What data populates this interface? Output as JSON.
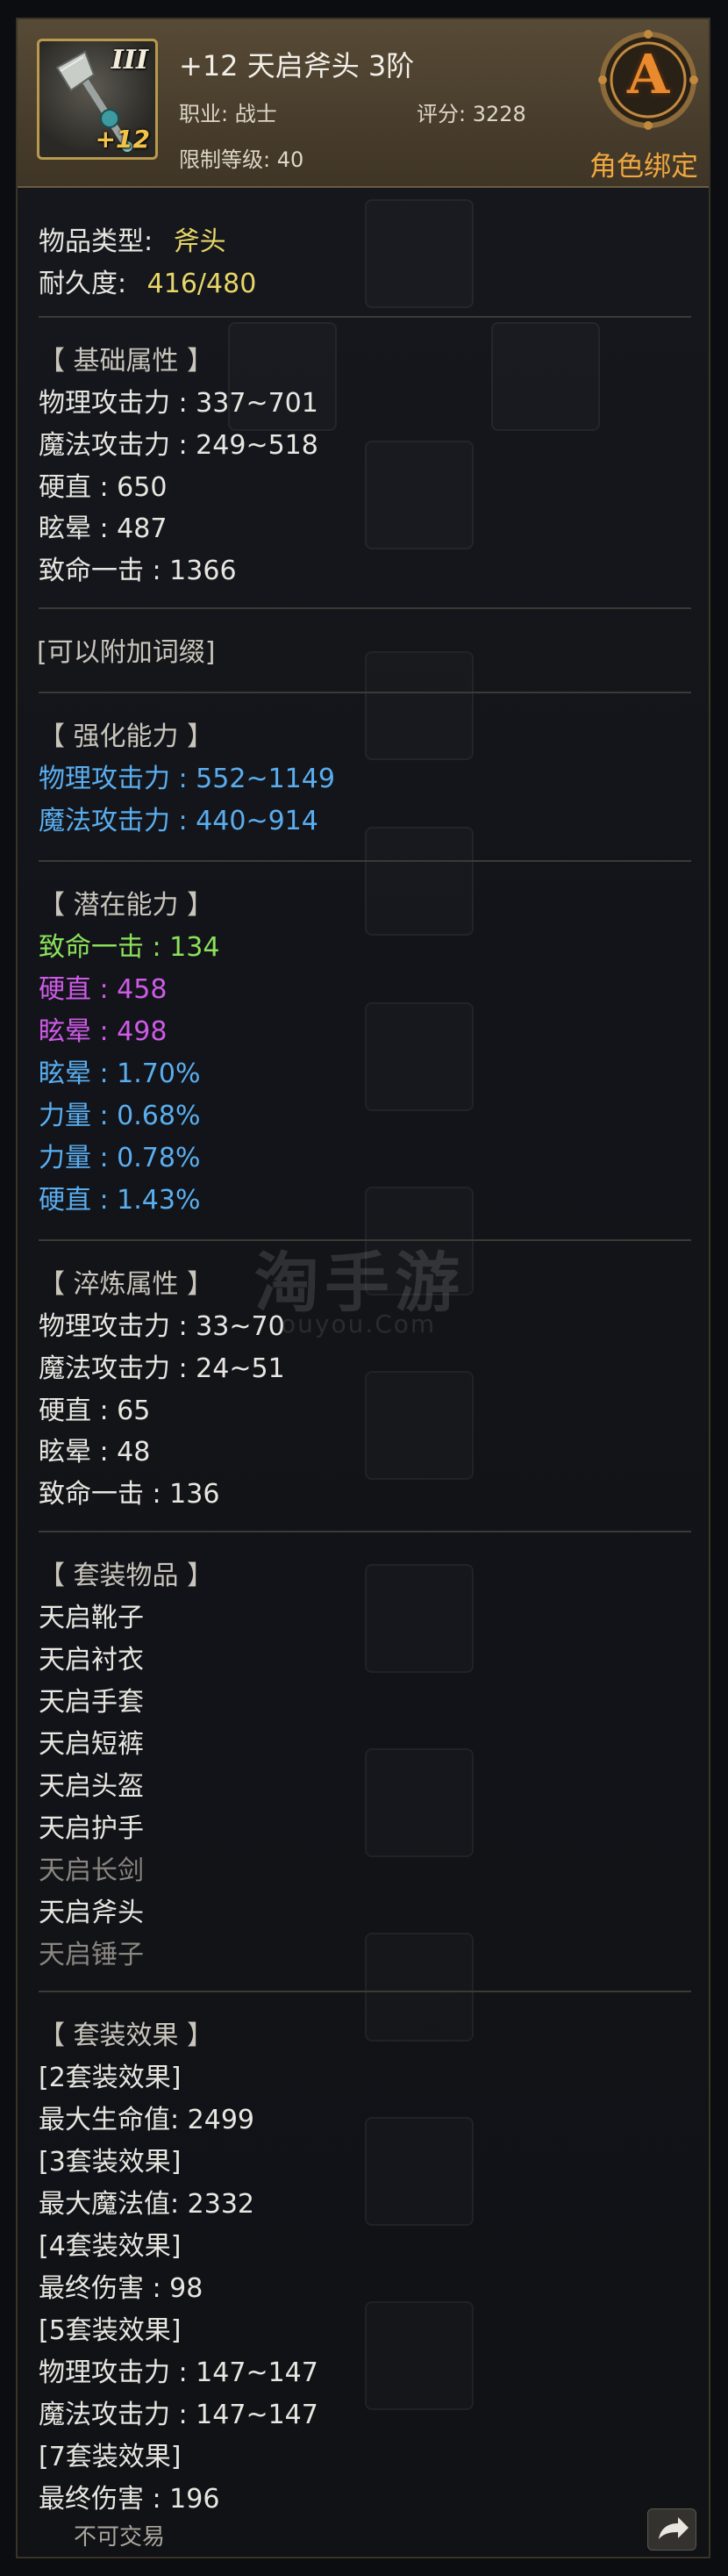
{
  "header": {
    "title": "+12 天启斧头 3阶",
    "job": "职业: 战士",
    "score": "评分: 3228",
    "level_req": "限制等级: 40",
    "grade": "A",
    "bind": "角色绑定",
    "icon_tier": "III",
    "icon_plus": "+12"
  },
  "basic": {
    "type_label": "物品类型:",
    "type_value": "斧头",
    "dur_label": "耐久度:",
    "dur_value": "416/480"
  },
  "base_stats": {
    "heading": "【 基础属性 】",
    "lines": [
      "物理攻击力 : 337~701",
      "魔法攻击力 : 249~518",
      "硬直 : 650",
      "眩晕 : 487",
      "致命一击 : 1366"
    ]
  },
  "affix": "[可以附加词缀]",
  "enhance": {
    "heading": "【 强化能力 】",
    "lines": [
      "物理攻击力 : 552~1149",
      "魔法攻击力 : 440~914"
    ]
  },
  "potential": {
    "heading": "【 潜在能力 】",
    "lines": [
      {
        "text": "致命一击 : 134",
        "color": "#8ce05a"
      },
      {
        "text": "硬直 : 458",
        "color": "#cf5ae8"
      },
      {
        "text": "眩晕 : 498",
        "color": "#cf5ae8"
      },
      {
        "text": "眩晕 : 1.70%",
        "color": "#5aaef0"
      },
      {
        "text": "力量 : 0.68%",
        "color": "#5aaef0"
      },
      {
        "text": "力量 : 0.78%",
        "color": "#5aaef0"
      },
      {
        "text": "硬直 : 1.43%",
        "color": "#5aaef0"
      }
    ]
  },
  "refine": {
    "heading": "【 淬炼属性 】",
    "lines": [
      "物理攻击力 : 33~70",
      "魔法攻击力 : 24~51",
      "硬直 : 65",
      "眩晕 : 48",
      "致命一击 : 136"
    ]
  },
  "set_items": {
    "heading": "【 套装物品 】",
    "items": [
      {
        "name": "天启靴子",
        "owned": true
      },
      {
        "name": "天启衬衣",
        "owned": true
      },
      {
        "name": "天启手套",
        "owned": true
      },
      {
        "name": "天启短裤",
        "owned": true
      },
      {
        "name": "天启头盔",
        "owned": true
      },
      {
        "name": "天启护手",
        "owned": true
      },
      {
        "name": "天启长剑",
        "owned": false
      },
      {
        "name": "天启斧头",
        "owned": true
      },
      {
        "name": "天启锤子",
        "owned": false
      }
    ]
  },
  "set_effects": {
    "heading": "【 套装效果 】",
    "lines": [
      "[2套装效果]",
      "最大生命值:   2499",
      "[3套装效果]",
      "最大魔法值:   2332",
      "[4套装效果]",
      "最终伤害 : 98",
      "[5套装效果]",
      "物理攻击力 : 147~147",
      "魔法攻击力 : 147~147",
      "[7套装效果]",
      "最终伤害 : 196"
    ]
  },
  "footer": {
    "trade": "不可交易",
    "share_icon": "share-arrow-icon"
  },
  "watermark": {
    "main": "淘手游",
    "sub": "ouyou.Com"
  }
}
